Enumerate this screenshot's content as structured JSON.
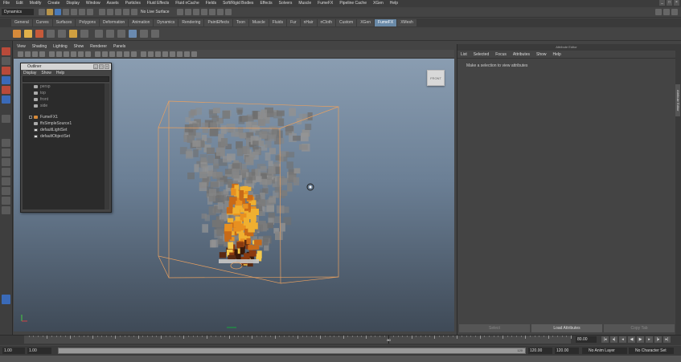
{
  "menubar": {
    "items": [
      "File",
      "Edit",
      "Modify",
      "Create",
      "Display",
      "Window",
      "Assets",
      "Particles",
      "Fluid Effects",
      "Fluid nCache",
      "Fields",
      "Soft/Rigid Bodies",
      "Effects",
      "Solvers",
      "Muscle",
      "FumeFX",
      "Pipeline Cache",
      "XGen",
      "Help"
    ]
  },
  "status": {
    "menuset": "Dynamics",
    "live_surface": "No Live Surface"
  },
  "shelf": {
    "tabs": [
      "General",
      "Curves",
      "Surfaces",
      "Polygons",
      "Deformation",
      "Animation",
      "Dynamics",
      "Rendering",
      "PaintEffects",
      "Toon",
      "Muscle",
      "Fluids",
      "Fur",
      "nHair",
      "nCloth",
      "Custom",
      "XGen",
      "FumeFX",
      "XMesh"
    ],
    "active_tab": "FumeFX"
  },
  "viewport": {
    "menu": [
      "View",
      "Shading",
      "Lighting",
      "Show",
      "Renderer",
      "Panels"
    ],
    "viewcube_label": "FRONT",
    "accent": "#e8a060"
  },
  "outliner": {
    "title": "Outliner",
    "menu": [
      "Display",
      "Show",
      "Help"
    ],
    "items": [
      {
        "label": "persp",
        "dim": true,
        "kind": "camera"
      },
      {
        "label": "top",
        "dim": true,
        "kind": "camera"
      },
      {
        "label": "front",
        "dim": true,
        "kind": "camera"
      },
      {
        "label": "side",
        "dim": true,
        "kind": "camera"
      },
      {
        "label": "FumeFX1",
        "dim": false,
        "kind": "fluid"
      },
      {
        "label": "ffxSimpleSource1",
        "dim": false,
        "kind": "source"
      },
      {
        "label": "defaultLightSet",
        "dim": false,
        "kind": "set"
      },
      {
        "label": "defaultObjectSet",
        "dim": false,
        "kind": "set"
      }
    ]
  },
  "attribute_editor": {
    "title": "Attribute Editor",
    "menu": [
      "List",
      "Selected",
      "Focus",
      "Attributes",
      "Show",
      "Help"
    ],
    "message": "Make a selection to view attributes",
    "buttons": [
      "Select",
      "Load Attributes",
      "Copy Tab"
    ],
    "side_tab": "Attribute Editor"
  },
  "timeline": {
    "ticks": [
      "5",
      "10",
      "15",
      "20",
      "25",
      "30",
      "35",
      "40",
      "45",
      "50",
      "55",
      "60",
      "65",
      "70",
      "75",
      "80",
      "85",
      "90",
      "95",
      "100",
      "105",
      "110",
      "115",
      "120"
    ],
    "current": "80",
    "current_field": "80.00"
  },
  "range": {
    "start_field": "1.00",
    "start_field2": "1.00",
    "range_end_label": "120",
    "end_field": "120.00",
    "end_field2": "120.00",
    "anim_layer": "No Anim Layer",
    "char_set": "No Character Set"
  }
}
